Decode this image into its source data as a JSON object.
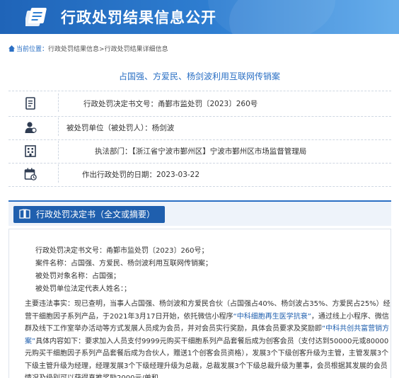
{
  "banner": {
    "title": "行政处罚结果信息公开"
  },
  "breadcrumb": {
    "label": "当前位置：",
    "item1": "行政处罚结果信息",
    "sep": ">",
    "item2": "行政处罚结果详细信息"
  },
  "case": {
    "title": "占国强、方爱民、杨剑波利用互联网传销案"
  },
  "info": {
    "decision_no_label": "行政处罚决定书文号：",
    "decision_no": "甬鄞市监处罚〔2023〕260号",
    "party_label": "被处罚单位（被处罚人）：",
    "party": "杨剑波",
    "authority_label": "执法部门：",
    "authority": "【浙江省宁波市鄞州区】宁波市鄞州区市场监督管理局",
    "date_label": "作出行政处罚的日期：",
    "date": "2023-03-22"
  },
  "section": {
    "title": "行政处罚决定书（全文或摘要）"
  },
  "content": {
    "line1": "行政处罚决定书文号：甬鄞市监处罚〔2023〕260号；",
    "line2": "案件名称：占国强、方爱民、杨剑波利用互联网传销案；",
    "line3": "被处罚对象名称：占国强；",
    "line4": "被处罚单位法定代表人姓名：；",
    "facts_a": "主要违法事实：现已查明，当事人占国强、杨剑波和方爱民合伙（占国强占40%、杨剑波占35%、方爱民占25%）经营干细胞因子系列产品，于2021年3月17日开始，依托微信小程序",
    "facts_b": "“中科细胞再生医学抗衰”",
    "facts_c": "，通过线上小程序、微信群及线下工作室举办活动等方式发展人员成为会员，并对会员实行奖励，具体会员要求及奖励即",
    "facts_d": "“中科共创共富营销方案”",
    "facts_e": "具体内容如下：要求加入人员支付9999元购买干细胞系列产品套餐后成为创客会员（支付达到50000元或80000元购买干细胞因子系列产品套餐后成为合伙人，赠送1个创客会员资格），发展3个下级创客升级为主管，主管发展3个下级主管升级为经理，经理发展3个下级经理升级为总裁，总裁发展3个下级总裁升级为董事，会员根据其发展的会员情况及级别可以获得直推奖励2000元/单和"
  }
}
